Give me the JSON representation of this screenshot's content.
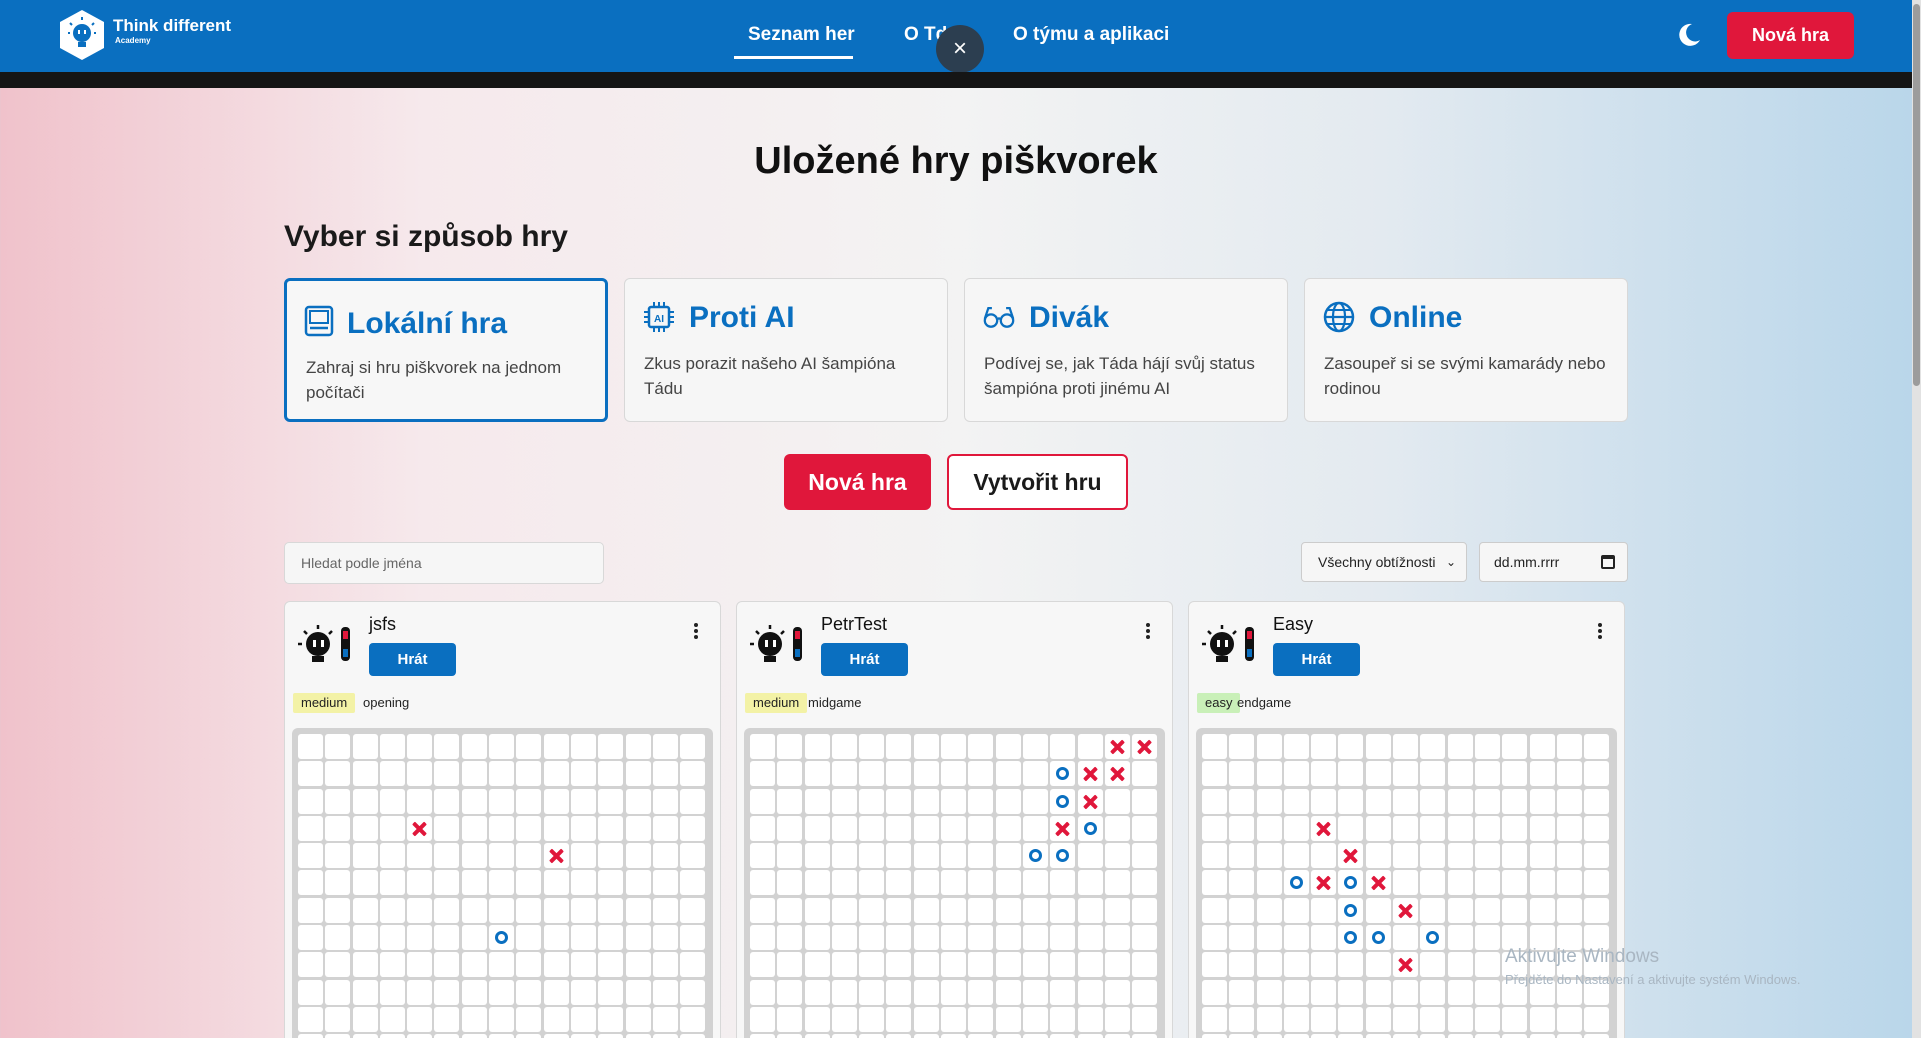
{
  "brand": {
    "title": "Think different",
    "subtitle": "Academy"
  },
  "nav": {
    "items": [
      "Seznam her",
      "O TdA",
      "O týmu a aplikaci"
    ],
    "active": "Seznam her"
  },
  "overlay_close_label": "×",
  "header_new_game": "Nová hra",
  "page_title": "Uložené hry piškvorek",
  "mode_section_title": "Vyber si způsob hry",
  "modes": [
    {
      "icon": "computer-icon",
      "title": "Lokální hra",
      "desc": "Zahraj si hru piškvorek na jednom počítači",
      "selected": true
    },
    {
      "icon": "chip-icon",
      "title": "Proti AI",
      "desc": "Zkus porazit našeho AI šampióna Tádu",
      "selected": false
    },
    {
      "icon": "glasses-icon",
      "title": "Divák",
      "desc": "Podívej se, jak Táda hájí svůj status šampióna proti jinému AI",
      "selected": false
    },
    {
      "icon": "globe-icon",
      "title": "Online",
      "desc": "Zasoupeř si se svými kamarády nebo rodinou",
      "selected": false
    }
  ],
  "actions": {
    "new_game": "Nová hra",
    "create_game": "Vytvořit hru"
  },
  "filters": {
    "search_placeholder": "Hledat podle jména",
    "difficulty_selected": "Všechny obtížnosti",
    "date_placeholder": "dd.mm.rrrr"
  },
  "games": [
    {
      "name": "jsfs",
      "play_label": "Hrát",
      "difficulty": "medium",
      "phase": "opening",
      "marks": [
        {
          "r": 3,
          "c": 4,
          "m": "X"
        },
        {
          "r": 4,
          "c": 9,
          "m": "X"
        },
        {
          "r": 7,
          "c": 7,
          "m": "O"
        }
      ]
    },
    {
      "name": "PetrTest",
      "play_label": "Hrát",
      "difficulty": "medium",
      "phase": "midgame",
      "marks": [
        {
          "r": 0,
          "c": 13,
          "m": "X"
        },
        {
          "r": 0,
          "c": 14,
          "m": "X"
        },
        {
          "r": 1,
          "c": 11,
          "m": "O"
        },
        {
          "r": 1,
          "c": 12,
          "m": "X"
        },
        {
          "r": 1,
          "c": 13,
          "m": "X"
        },
        {
          "r": 2,
          "c": 11,
          "m": "O"
        },
        {
          "r": 2,
          "c": 12,
          "m": "X"
        },
        {
          "r": 3,
          "c": 11,
          "m": "X"
        },
        {
          "r": 3,
          "c": 12,
          "m": "O"
        },
        {
          "r": 4,
          "c": 10,
          "m": "O"
        },
        {
          "r": 4,
          "c": 11,
          "m": "O"
        }
      ]
    },
    {
      "name": "Easy",
      "play_label": "Hrát",
      "difficulty": "easy",
      "phase": "endgame",
      "marks": [
        {
          "r": 3,
          "c": 4,
          "m": "X"
        },
        {
          "r": 4,
          "c": 5,
          "m": "X"
        },
        {
          "r": 5,
          "c": 3,
          "m": "O"
        },
        {
          "r": 5,
          "c": 4,
          "m": "X"
        },
        {
          "r": 5,
          "c": 5,
          "m": "O"
        },
        {
          "r": 5,
          "c": 6,
          "m": "X"
        },
        {
          "r": 6,
          "c": 5,
          "m": "O"
        },
        {
          "r": 6,
          "c": 7,
          "m": "X"
        },
        {
          "r": 7,
          "c": 5,
          "m": "O"
        },
        {
          "r": 7,
          "c": 6,
          "m": "O"
        },
        {
          "r": 7,
          "c": 8,
          "m": "O"
        },
        {
          "r": 8,
          "c": 7,
          "m": "X"
        }
      ]
    }
  ],
  "watermark": {
    "title": "Aktivujte Windows",
    "subtitle": "Přejděte do Nastavení a aktivujte systém Windows."
  },
  "colors": {
    "primary": "#0a6fc0",
    "accent": "#e0173b",
    "x_mark": "#e0173b",
    "o_mark": "#0a6fc0"
  }
}
